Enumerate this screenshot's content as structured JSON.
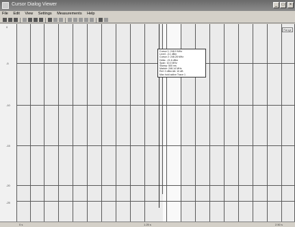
{
  "window": {
    "title": "Cursor Dialog Viewer",
    "buttons": [
      "_",
      "□",
      "×"
    ]
  },
  "menu": [
    "File",
    "Edit",
    "View",
    "Settings",
    "Measurements",
    "Help"
  ],
  "plot": {
    "y_ticks": [
      "0",
      "-5",
      "-10",
      "-15",
      "-20",
      "-25"
    ],
    "range_label": "Range",
    "x_start": "0 s",
    "x_mid": "1.25 s",
    "x_end": "2.50 s"
  },
  "tooltip": {
    "lines": [
      "Cursor 1: 248.0 MHz",
      "Level: -3.1 dBm",
      "Cursor 2: 248.28 MHz",
      "Delta: -21.6 dBm",
      "Span: 10.0 MHz",
      "Sweep: 500 ms",
      "Marker: 248.14 MHz",
      "Ref: 0 dBm  Att: 10 dB",
      "Max hold active  Trace 1"
    ]
  }
}
